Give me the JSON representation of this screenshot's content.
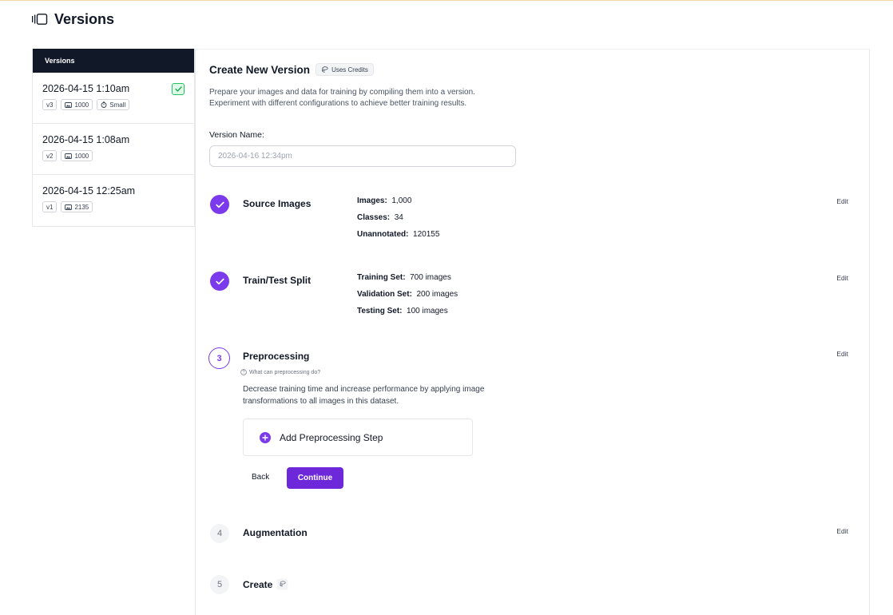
{
  "header": {
    "title": "Versions",
    "icon": "panel-toggle-icon"
  },
  "sidebar": {
    "heading": "Versions",
    "items": [
      {
        "date": "2026-04-15 1:10am",
        "version": "v3",
        "images": "1000",
        "size": "Small",
        "selected": true
      },
      {
        "date": "2026-04-15 1:08am",
        "version": "v2",
        "images": "1000"
      },
      {
        "date": "2026-04-15 12:25am",
        "version": "v1",
        "images": "2135"
      }
    ]
  },
  "main": {
    "title": "Create New Version",
    "credits_badge": "Uses Credits",
    "intro_line1": "Prepare your images and data for training by compiling them into a version.",
    "intro_line2": "Experiment with different configurations to achieve better training results.",
    "version_name_label": "Version Name:",
    "version_name_placeholder": "2026-04-16 12:34pm",
    "edit_label": "Edit",
    "steps": {
      "source": {
        "title": "Source Images",
        "images_label": "Images:",
        "images_value": "1,000",
        "classes_label": "Classes:",
        "classes_value": "34",
        "unannotated_label": "Unannotated:",
        "unannotated_value": "120155"
      },
      "split": {
        "title": "Train/Test Split",
        "train_label": "Training Set:",
        "train_value": "700 images",
        "valid_label": "Validation Set:",
        "valid_value": "200 images",
        "test_label": "Testing Set:",
        "test_value": "100 images"
      },
      "preprocessing": {
        "number": "3",
        "title": "Preprocessing",
        "help": "What can preprocessing do?",
        "desc_line1": "Decrease training time and increase performance by applying image",
        "desc_line2": "transformations to all images in this dataset.",
        "add_step": "Add Preprocessing Step",
        "back": "Back",
        "continue": "Continue"
      },
      "augmentation": {
        "number": "4",
        "title": "Augmentation"
      },
      "create": {
        "number": "5",
        "title": "Create"
      }
    }
  },
  "colors": {
    "accent": "#7c3aed",
    "sidebar_head": "#111827",
    "success": "#22c55e"
  }
}
